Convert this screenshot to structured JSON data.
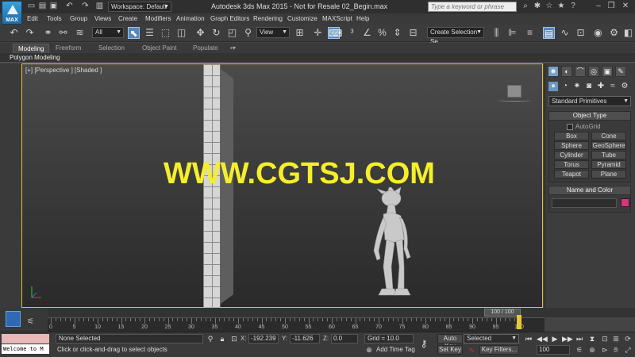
{
  "app": {
    "logo_text": "MAX",
    "title": "Autodesk 3ds Max  2015   - Not for Resale    02_Begin.max",
    "workspace": "Workspace: Default",
    "search_placeholder": "Type a keyword or phrase"
  },
  "menu": [
    "Edit",
    "Tools",
    "Group",
    "Views",
    "Create",
    "Modifiers",
    "Animation",
    "Graph Editors",
    "Rendering",
    "Customize",
    "MAXScript",
    "Help"
  ],
  "toolbar": {
    "filter": "All",
    "ref_coord": "View",
    "named_selection_placeholder": "Create Selection Se"
  },
  "ribbon": {
    "tabs": [
      "Modeling",
      "Freeform",
      "Selection",
      "Object Paint",
      "Populate"
    ],
    "active_tab": "Modeling",
    "subpanel": "Polygon Modeling"
  },
  "viewport": {
    "label": "[+] [Perspective ] [Shaded ]",
    "watermark": "WWW.CGTSJ.COM"
  },
  "command_panel": {
    "category": "Standard Primitives",
    "object_type_title": "Object Type",
    "autogrid": "AutoGrid",
    "primitives": [
      "Box",
      "Cone",
      "Sphere",
      "GeoSphere",
      "Cylinder",
      "Tube",
      "Torus",
      "Pyramid",
      "Teapot",
      "Plane"
    ],
    "name_color_title": "Name and Color",
    "swatch_color": "#d4377d"
  },
  "timeline": {
    "slider": "100 / 100",
    "ticks": [
      "0",
      "5",
      "10",
      "15",
      "20",
      "25",
      "30",
      "35",
      "40",
      "45",
      "50",
      "55",
      "60",
      "65",
      "70",
      "75",
      "80",
      "85",
      "90",
      "95",
      "100"
    ],
    "current_frame": "100"
  },
  "status": {
    "listener": "Welcome to M",
    "selection": "None Selected",
    "prompt": "Click or click-and-drag to select objects",
    "x_label": "X:",
    "x_value": "-192.239",
    "y_label": "Y:",
    "y_value": "-11.626",
    "z_label": "Z:",
    "z_value": "0.0",
    "grid": "Grid = 10.0",
    "add_time_tag": "Add Time Tag",
    "auto_key": "Auto Key",
    "set_key": "Set Key",
    "key_mode": "Selected",
    "key_filters": "Key Filters...",
    "frame_value": "100"
  }
}
